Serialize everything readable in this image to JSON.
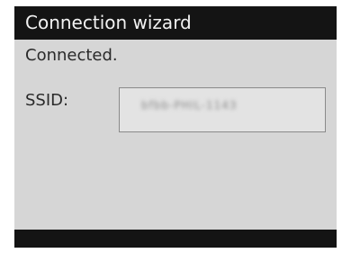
{
  "window": {
    "title": "Connection wizard"
  },
  "main": {
    "status_text": "Connected.",
    "ssid_label": "SSID:",
    "ssid_value": "bfbb-PHIL-1143"
  }
}
